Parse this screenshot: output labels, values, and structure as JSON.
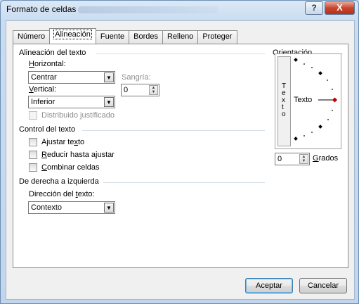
{
  "window": {
    "title": "Formato de celdas",
    "help_label": "?",
    "close_label": "X"
  },
  "tabs": [
    {
      "label": "Número",
      "active": false
    },
    {
      "label": "Alineación",
      "active": true
    },
    {
      "label": "Fuente",
      "active": false
    },
    {
      "label": "Bordes",
      "active": false
    },
    {
      "label": "Relleno",
      "active": false
    },
    {
      "label": "Proteger",
      "active": false
    }
  ],
  "text_alignment": {
    "group_title": "Alineación del texto",
    "horizontal_label_first": "H",
    "horizontal_label_rest": "orizontal:",
    "horizontal_value": "Centrar",
    "indent_label": "Sangría:",
    "indent_value": "0",
    "vertical_label_first": "V",
    "vertical_label_rest": "ertical:",
    "vertical_value": "Inferior",
    "distributed_label": "Distribuido justificado",
    "distributed_checked": false
  },
  "text_control": {
    "group_title": "Control del texto",
    "wrap_label_pre": "Ajustar te",
    "wrap_label_u": "x",
    "wrap_label_post": "to",
    "wrap_checked": false,
    "shrink_label_u": "R",
    "shrink_label_rest": "educir hasta ajustar",
    "shrink_checked": false,
    "merge_label_u": "C",
    "merge_label_rest": "ombinar celdas",
    "merge_checked": false
  },
  "rtl": {
    "group_title": "De derecha a izquierda",
    "direction_label_pre": "Dirección del ",
    "direction_label_u": "t",
    "direction_label_post": "exto:",
    "direction_value": "Contexto"
  },
  "orientation": {
    "group_title": "Orientación",
    "vertical_letters": [
      "T",
      "e",
      "x",
      "t",
      "o"
    ],
    "dial_text": "Texto",
    "degrees_value": "0",
    "degrees_label_u": "G",
    "degrees_label_rest": "rados"
  },
  "buttons": {
    "ok": "Aceptar",
    "cancel": "Cancelar"
  },
  "colors": {
    "dial_marker": "#c00000",
    "accent_border": "#3c7fb1"
  },
  "icons": {
    "combo_arrow": "▼",
    "spin_up": "▲",
    "spin_down": "▼"
  }
}
